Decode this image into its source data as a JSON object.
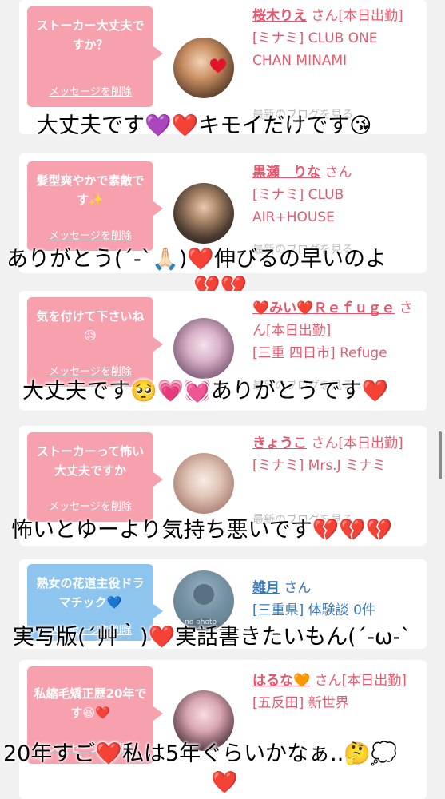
{
  "entries": [
    {
      "bubble_text": "ストーカー大丈夫ですか？",
      "delete_label": "メッセージを削除",
      "name": "桜木りえ",
      "san": "さん[本日出勤]",
      "shop": "[ミナミ] CLUB ONE CHAN MINAMI",
      "blog_link": "最新のブログを見る",
      "comment": "大丈夫です💜❤️キモイだけです😘"
    },
    {
      "bubble_text": "髪型爽やかで素敵です✨",
      "delete_label": "メッセージを削除",
      "name": "黒瀬　りな",
      "san": "さん",
      "shop": "[ミナミ] CLUB AIR+HOUSE",
      "blog_link": "最新のブログを見る",
      "comment": "ありがとう(´-`🙏🏻)❤️伸びるの早いのよ",
      "comment_line2": "💔💔"
    },
    {
      "bubble_text": "気を付けて下さいね😥",
      "delete_label": "メッセージを削除",
      "name": "❤️みい❤️Ｒｅｆｕｇｅ",
      "san": "さん[本日出勤]",
      "shop": "[三重 四日市] Refuge",
      "blog_link": "最新のブログを見る",
      "comment": "大丈夫です🥺💗💓ありがとうです❤️"
    },
    {
      "bubble_text": "ストーカーって怖い大丈夫ですか",
      "delete_label": "メッセージを削除",
      "name": "きょうこ",
      "san": "さん[本日出勤]",
      "shop": "[ミナミ] Mrs.J ミナミ",
      "blog_link": "最新のブログを見る",
      "comment": "怖いとゆーより気持ち悪いです💔💔💔"
    },
    {
      "bubble_text": "熟女の花道主役ドラマチック💙",
      "delete_label": "メッセージを削除",
      "name": "雑月",
      "san": "さん",
      "shop": "[三重県] 体験談 0件",
      "avatar_label": "no photo",
      "comment": "実写版(´艸｀)❤️実話書きたいもん(´-ω-`"
    },
    {
      "bubble_text": "私縮毛矯正歴20年です😆❤️",
      "delete_label": "メッセージを削除",
      "name": "はるな🧡",
      "san": "さん[本日出勤]",
      "shop": "[五反田] 新世界",
      "comment": "20年すご❤️私は5年ぐらいかなぁ..🤔💭",
      "comment_line2": "❤️"
    }
  ],
  "colors": {
    "bubble_pink": "#f7a0ae",
    "bubble_blue": "#8dc5ef",
    "name_pink": "#e9546b",
    "name_blue": "#3b78b8",
    "heart_red": "#d9151b"
  }
}
